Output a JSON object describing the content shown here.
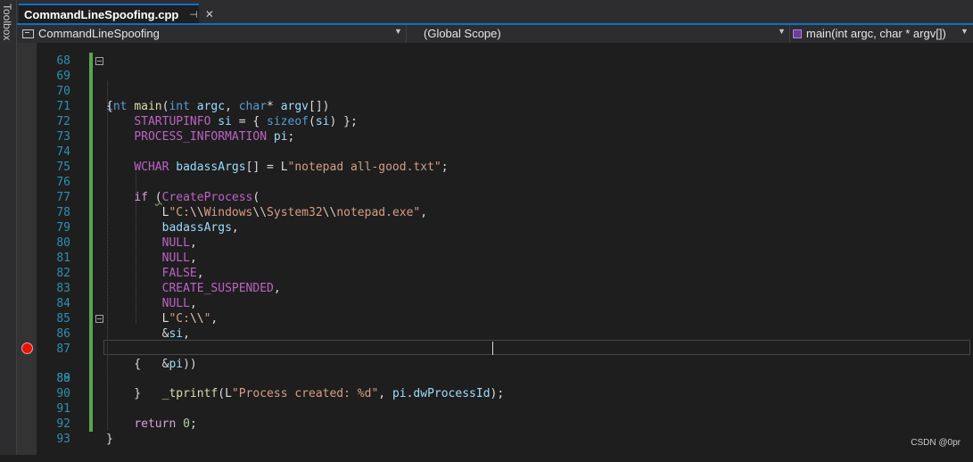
{
  "toolbox": {
    "label": "Toolbox"
  },
  "tab": {
    "title": "CommandLineSpoofing.cpp",
    "pin_glyph": "⊣",
    "close_glyph": "✕"
  },
  "navbar": {
    "project": "CommandLineSpoofing",
    "scope": "(Global Scope)",
    "member": "main(int argc, char * argv[])"
  },
  "editor": {
    "line_numbers": [
      "68",
      "69",
      "70",
      "71",
      "72",
      "73",
      "74",
      "75",
      "76",
      "77",
      "78",
      "79",
      "80",
      "81",
      "82",
      "83",
      "84",
      "85",
      "86",
      "87",
      "88",
      "89",
      "90",
      "91",
      "92",
      "93"
    ],
    "breakpoint_line": "88",
    "lines": [
      "",
      "int main(int argc, char* argv[])",
      "{",
      "    STARTUPINFO si = { sizeof(si) };",
      "    PROCESS_INFORMATION pi;",
      "",
      "    WCHAR badassArgs[] = L\"notepad all-good.txt\";",
      "",
      "    if (CreateProcess(",
      "        L\"C:\\\\Windows\\\\System32\\\\notepad.exe\",",
      "        badassArgs,",
      "        NULL,",
      "        NULL,",
      "        FALSE,",
      "        CREATE_SUSPENDED,",
      "        NULL,",
      "        L\"C:\\\\\",",
      "        &si,",
      "        &pi))",
      "    {",
      "        _tprintf(L\"Process created: %d\", pi.dwProcessId);",
      "    }",
      "",
      "    return 0;",
      "}",
      ""
    ]
  },
  "watermark": "CSDN @0pr",
  "colors": {
    "accent": "#0e70c0",
    "breakpoint": "#e51400",
    "change_bar": "#57a64a"
  }
}
